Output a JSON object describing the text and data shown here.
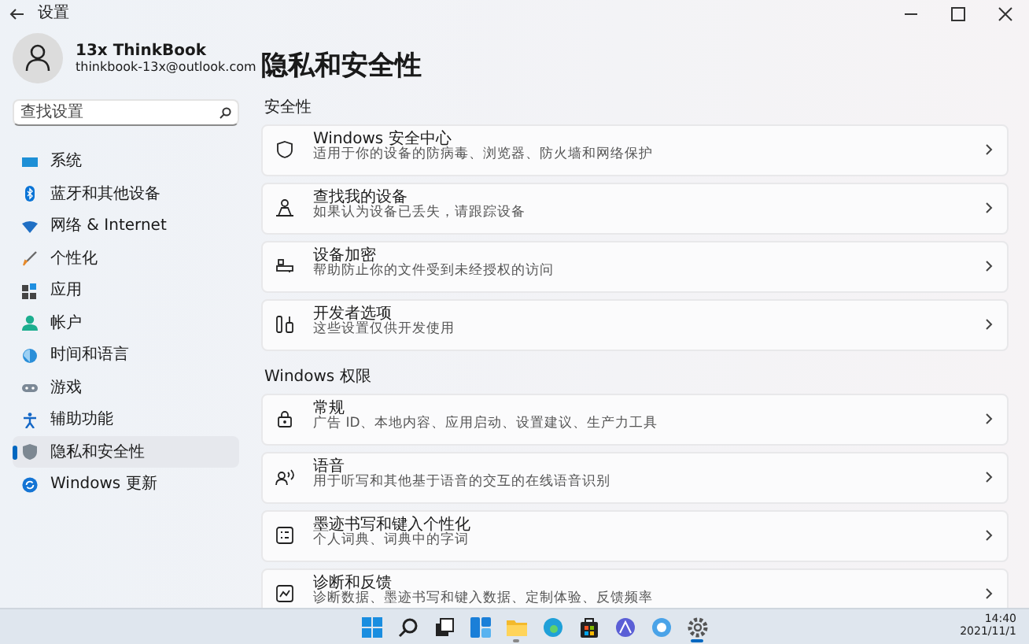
{
  "window": {
    "title": "设置"
  },
  "user": {
    "name": "13x ThinkBook",
    "email": "thinkbook-13x@outlook.com"
  },
  "search": {
    "placeholder": "查找设置"
  },
  "nav": [
    {
      "label": "系统",
      "selected": false
    },
    {
      "label": "蓝牙和其他设备",
      "selected": false
    },
    {
      "label": "网络 & Internet",
      "selected": false
    },
    {
      "label": "个性化",
      "selected": false
    },
    {
      "label": "应用",
      "selected": false
    },
    {
      "label": "帐户",
      "selected": false
    },
    {
      "label": "时间和语言",
      "selected": false
    },
    {
      "label": "游戏",
      "selected": false
    },
    {
      "label": "辅助功能",
      "selected": false
    },
    {
      "label": "隐私和安全性",
      "selected": true
    },
    {
      "label": "Windows 更新",
      "selected": false
    }
  ],
  "page": {
    "title": "隐私和安全性"
  },
  "sections": [
    {
      "heading": "安全性",
      "items": [
        {
          "title": "Windows 安全中心",
          "description": "适用于你的设备的防病毒、浏览器、防火墙和网络保护"
        },
        {
          "title": "查找我的设备",
          "description": "如果认为设备已丢失，请跟踪设备"
        },
        {
          "title": "设备加密",
          "description": "帮助防止你的文件受到未经授权的访问"
        },
        {
          "title": "开发者选项",
          "description": "这些设置仅供开发使用"
        }
      ]
    },
    {
      "heading": "Windows 权限",
      "items": [
        {
          "title": "常规",
          "description": "广告 ID、本地内容、应用启动、设置建议、生产力工具"
        },
        {
          "title": "语音",
          "description": "用于听写和其他基于语音的交互的在线语音识别"
        },
        {
          "title": "墨迹书写和键入个性化",
          "description": "个人词典、词典中的字词"
        },
        {
          "title": "诊断和反馈",
          "description": "诊断数据、墨迹书写和键入数据、定制体验、反馈频率"
        }
      ]
    }
  ],
  "taskbar": {
    "apps": [
      {
        "running": false,
        "selected": false
      },
      {
        "running": false,
        "selected": false
      },
      {
        "running": false,
        "selected": false
      },
      {
        "running": false,
        "selected": false
      },
      {
        "running": true,
        "selected": false
      },
      {
        "running": false,
        "selected": false
      },
      {
        "running": false,
        "selected": false
      },
      {
        "running": false,
        "selected": false
      },
      {
        "running": false,
        "selected": false
      },
      {
        "running": true,
        "selected": true
      }
    ],
    "time": "14:40",
    "date": "2021/11/1"
  }
}
